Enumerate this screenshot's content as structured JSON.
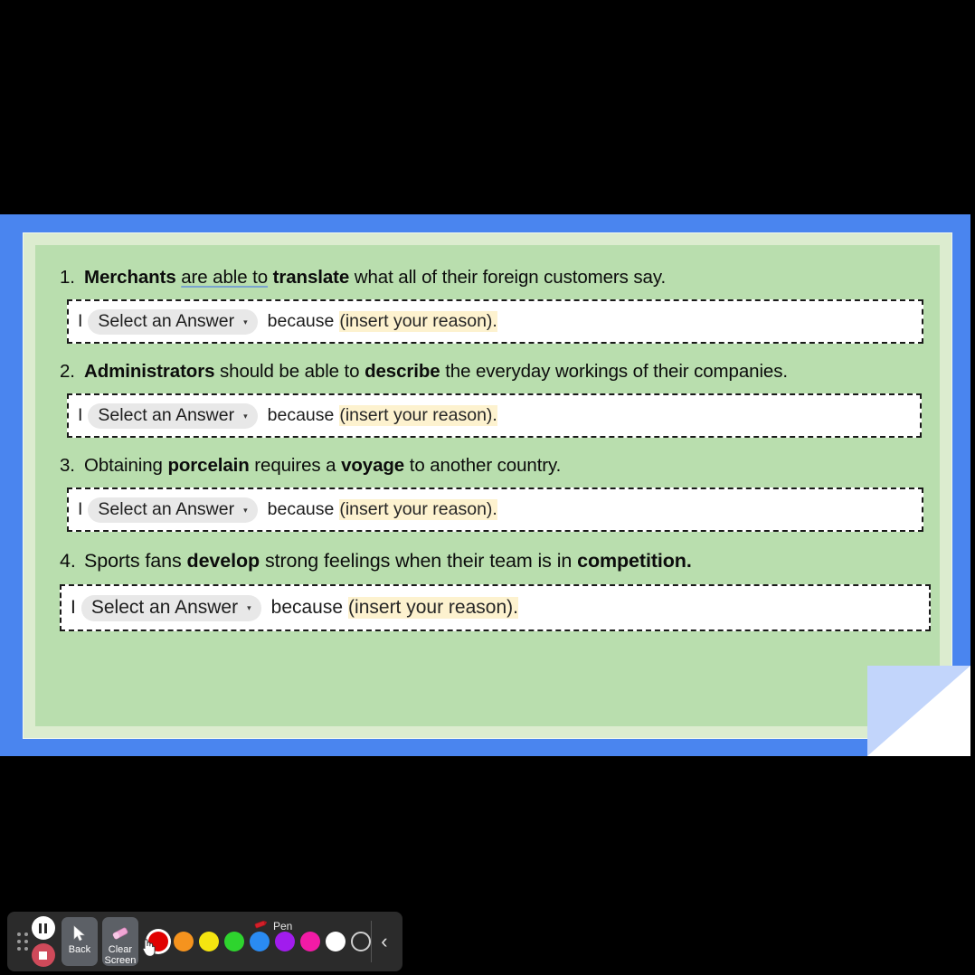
{
  "screen": {
    "background_color": "#4a85ef",
    "document_outer_color": "#dceccf",
    "document_inner_color": "#b9deae"
  },
  "worksheet": {
    "questions": [
      {
        "number": "1.",
        "segments": [
          {
            "text": "Merchants",
            "style": "bold"
          },
          {
            "text": " ",
            "style": "normal"
          },
          {
            "text": "are able to",
            "style": "underline"
          },
          {
            "text": " ",
            "style": "normal"
          },
          {
            "text": "translate",
            "style": "bold"
          },
          {
            "text": " what all of their foreign customers say.",
            "style": "normal"
          }
        ],
        "plain": "Merchants are able to translate what all of their foreign customers say.",
        "answer": {
          "caret": "I",
          "select_label": "Select an Answer",
          "select_caret": "▾",
          "connector": "because",
          "reason_placeholder": "(insert your reason)."
        }
      },
      {
        "number": "2.",
        "segments": [
          {
            "text": "Administrators",
            "style": "bold"
          },
          {
            "text": " should be able to ",
            "style": "normal"
          },
          {
            "text": "describe",
            "style": "bold"
          },
          {
            "text": " the everyday workings of their companies.",
            "style": "normal"
          }
        ],
        "plain": "Administrators should be able to describe the everyday workings of their companies.",
        "answer": {
          "caret": "I",
          "select_label": "Select an Answer",
          "select_caret": "▾",
          "connector": "because",
          "reason_placeholder": "(insert your reason)."
        }
      },
      {
        "number": "3.",
        "segments": [
          {
            "text": "Obtaining ",
            "style": "normal"
          },
          {
            "text": "porcelain",
            "style": "bold"
          },
          {
            "text": " requires a ",
            "style": "normal"
          },
          {
            "text": "voyage",
            "style": "bold"
          },
          {
            "text": " to another country.",
            "style": "normal"
          }
        ],
        "plain": "Obtaining porcelain requires a voyage to another country.",
        "answer": {
          "caret": "I",
          "select_label": "Select an Answer",
          "select_caret": "▾",
          "connector": "because",
          "reason_placeholder": "(insert your reason)."
        }
      },
      {
        "number": "4.",
        "segments": [
          {
            "text": "Sports fans ",
            "style": "normal"
          },
          {
            "text": "develop",
            "style": "bold"
          },
          {
            "text": " strong feelings when their team is in ",
            "style": "normal"
          },
          {
            "text": "competition.",
            "style": "bold"
          }
        ],
        "plain": "Sports fans develop strong feelings when their team is in competition.",
        "answer": {
          "caret": "I",
          "select_label": "Select an Answer",
          "select_caret": "▾",
          "connector": "because",
          "reason_placeholder": "(insert your reason)."
        }
      }
    ],
    "highlight_color": "#fdf2cf",
    "underline_color": "#7aa3cf"
  },
  "toolbar": {
    "background_color": "#2b2b2b",
    "drag_handle_name": "drag-handle",
    "pause_button_label": "",
    "stop_button_label": "",
    "stop_button_color": "#cf4a5a",
    "back_button_label": "Back",
    "clear_screen_label_line1": "Clear",
    "clear_screen_label_line2": "Screen",
    "active_tool_label": "Pen",
    "collapse_caret": "‹",
    "colors": [
      {
        "name": "red",
        "hex": "#e00000",
        "selected": true
      },
      {
        "name": "orange",
        "hex": "#f5931e",
        "selected": false
      },
      {
        "name": "yellow",
        "hex": "#f5e510",
        "selected": false
      },
      {
        "name": "green",
        "hex": "#2ed42e",
        "selected": false
      },
      {
        "name": "blue",
        "hex": "#2a8bf2",
        "selected": false
      },
      {
        "name": "purple",
        "hex": "#a11ced",
        "selected": false
      },
      {
        "name": "magenta",
        "hex": "#f21ba6",
        "selected": false
      },
      {
        "name": "white",
        "hex": "#ffffff",
        "selected": false
      },
      {
        "name": "transparent",
        "hex": "transparent",
        "selected": false
      }
    ]
  }
}
